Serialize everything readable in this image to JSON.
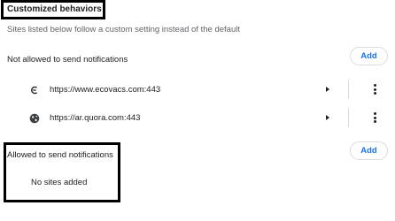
{
  "section": {
    "heading": "Customized behaviors",
    "description": "Sites listed below follow a custom setting instead of the default"
  },
  "blocked": {
    "label": "Not allowed to send notifications",
    "add_label": "Add",
    "sites": [
      {
        "url": "https://www.ecovacs.com:443",
        "icon": "ecovacs-favicon-icon"
      },
      {
        "url": "https://ar.quora.com:443",
        "icon": "globe-icon"
      }
    ]
  },
  "allowed": {
    "label": "Allowed to send notifications",
    "add_label": "Add",
    "empty_text": "No sites added"
  },
  "colors": {
    "accent": "#1a73e8",
    "text": "#202124",
    "secondary_text": "#5f6368",
    "border": "#dadce0",
    "highlight_box": "#000000"
  }
}
